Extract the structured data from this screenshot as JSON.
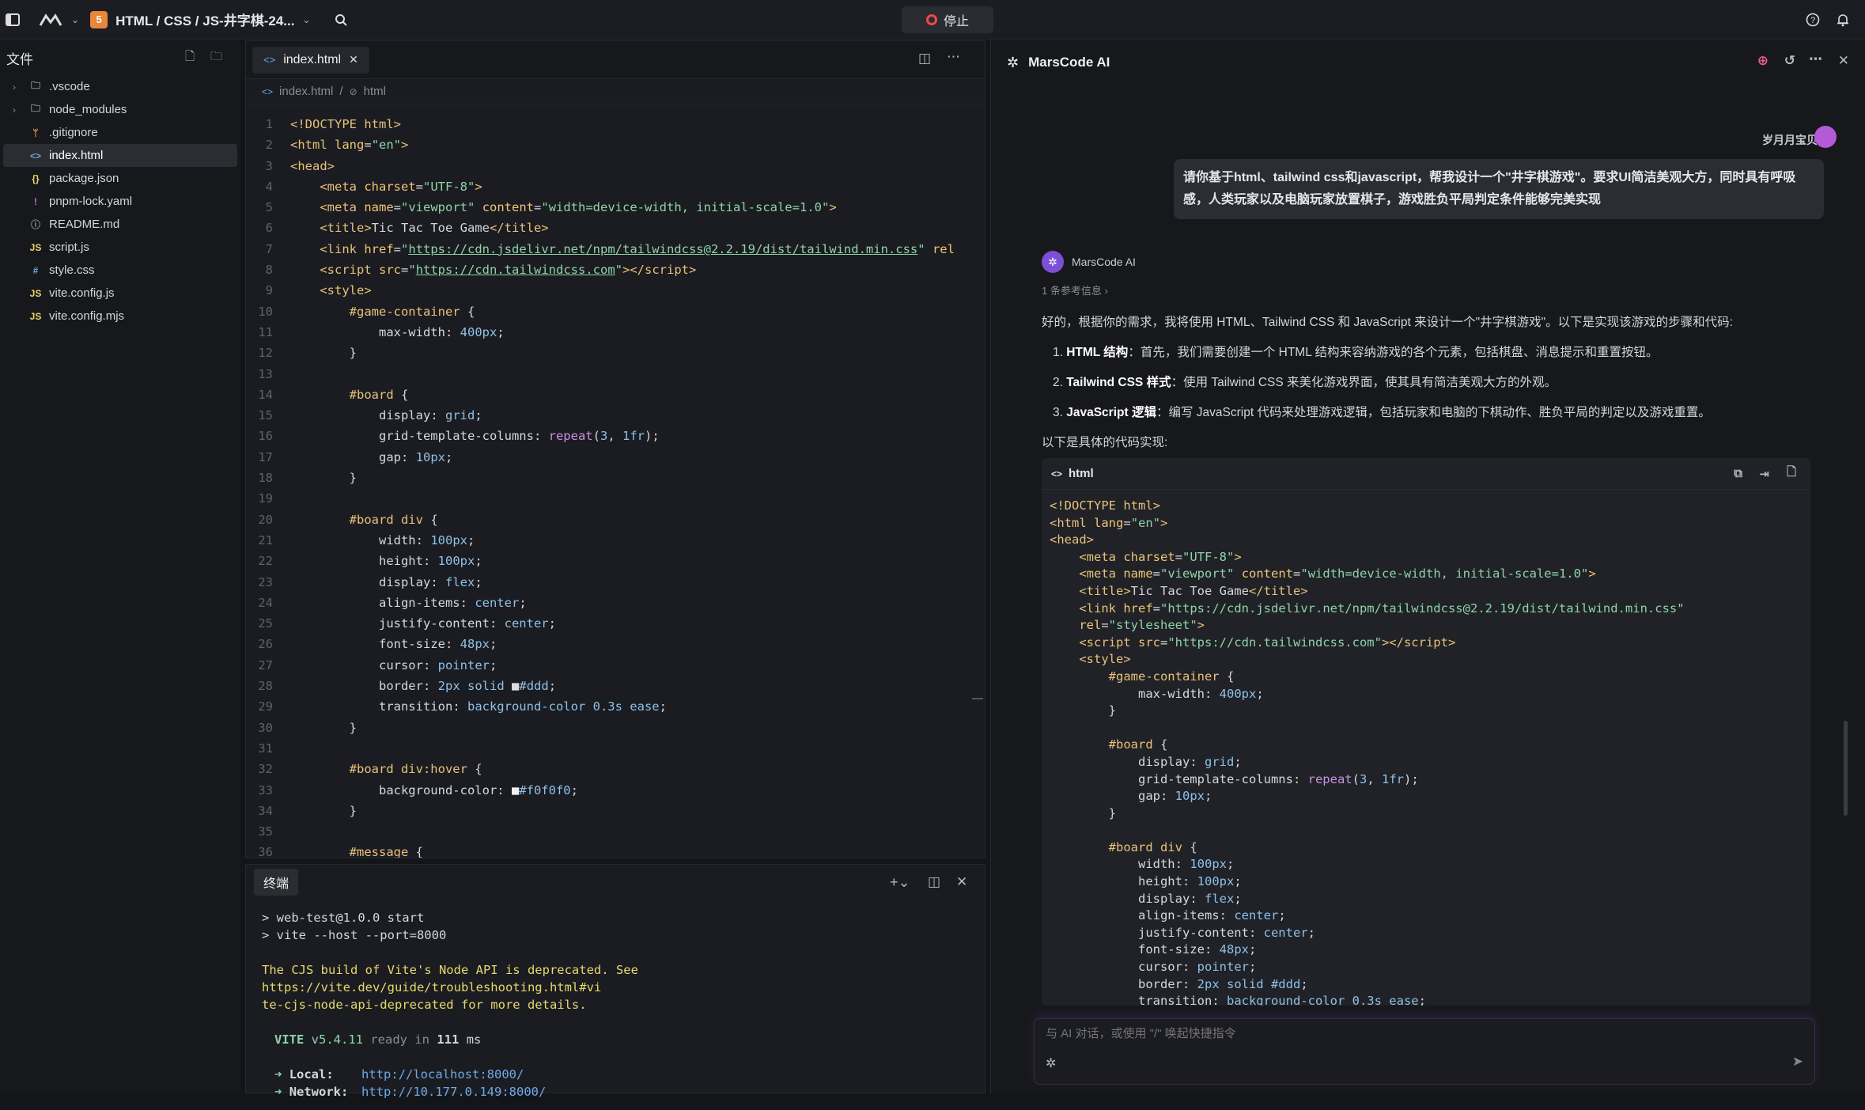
{
  "topbar": {
    "project_title": "HTML / CSS / JS-井字棋-24...",
    "stop_label": "停止",
    "badge": "5"
  },
  "sidebar": {
    "title": "文件",
    "items": [
      {
        "name": ".vscode",
        "icon": "folder-icon",
        "chev": true
      },
      {
        "name": "node_modules",
        "icon": "folder-icon",
        "chev": true
      },
      {
        "name": ".gitignore",
        "icon": "git-icon"
      },
      {
        "name": "index.html",
        "icon": "html-icon",
        "selected": true
      },
      {
        "name": "package.json",
        "icon": "json-icon"
      },
      {
        "name": "pnpm-lock.yaml",
        "icon": "yaml-icon"
      },
      {
        "name": "README.md",
        "icon": "info-icon"
      },
      {
        "name": "script.js",
        "icon": "js-icon"
      },
      {
        "name": "style.css",
        "icon": "css-icon"
      },
      {
        "name": "vite.config.js",
        "icon": "js-icon"
      },
      {
        "name": "vite.config.mjs",
        "icon": "js-icon"
      }
    ]
  },
  "editor": {
    "tab": "index.html",
    "breadcrumb": [
      "index.html",
      "html"
    ],
    "lines": [
      {
        "n": "1",
        "html": "<span class=\"t-tag\">&lt;!DOCTYPE html&gt;</span>"
      },
      {
        "n": "2",
        "html": "<span class=\"t-tag\">&lt;html</span> <span class=\"t-att\">lang</span>=<span class=\"t-str\">\"en\"</span><span class=\"t-tag\">&gt;</span>"
      },
      {
        "n": "3",
        "html": "<span class=\"t-tag\">&lt;head&gt;</span>"
      },
      {
        "n": "4",
        "html": "    <span class=\"t-tag\">&lt;meta</span> <span class=\"t-att\">charset</span>=<span class=\"t-str\">\"UTF-8\"</span><span class=\"t-tag\">&gt;</span>"
      },
      {
        "n": "5",
        "html": "    <span class=\"t-tag\">&lt;meta</span> <span class=\"t-att\">name</span>=<span class=\"t-str\">\"viewport\"</span> <span class=\"t-att\">content</span>=<span class=\"t-str\">\"width=device-width, initial-scale=1.0\"</span><span class=\"t-tag\">&gt;</span>"
      },
      {
        "n": "6",
        "html": "    <span class=\"t-tag\">&lt;title&gt;</span>Tic Tac Toe Game<span class=\"t-tag\">&lt;/title&gt;</span>"
      },
      {
        "n": "7",
        "html": "    <span class=\"t-tag\">&lt;link</span> <span class=\"t-att\">href</span>=<span class=\"t-str\">\"</span><span class=\"t-url\">https://cdn.jsdelivr.net/npm/tailwindcss@2.2.19/dist/tailwind.min.css</span><span class=\"t-str\">\"</span> <span class=\"t-att\">rel</span>"
      },
      {
        "n": "8",
        "html": "    <span class=\"t-tag\">&lt;script</span> <span class=\"t-att\">src</span>=<span class=\"t-str\">\"</span><span class=\"t-url\">https://cdn.tailwindcss.com</span><span class=\"t-str\">\"</span><span class=\"t-tag\">&gt;&lt;/script&gt;</span>"
      },
      {
        "n": "9",
        "html": "    <span class=\"t-tag\">&lt;style&gt;</span>"
      },
      {
        "n": "10",
        "html": "        <span class=\"t-sel\">#game-container</span> {"
      },
      {
        "n": "11",
        "html": "            <span class=\"t-prop\">max-width</span>: <span class=\"t-val\">400px</span>;"
      },
      {
        "n": "12",
        "html": "        }"
      },
      {
        "n": "13",
        "html": ""
      },
      {
        "n": "14",
        "html": "        <span class=\"t-sel\">#board</span> {"
      },
      {
        "n": "15",
        "html": "            <span class=\"t-prop\">display</span>: <span class=\"t-val\">grid</span>;"
      },
      {
        "n": "16",
        "html": "            <span class=\"t-prop\">grid-template-columns</span>: <span class=\"t-kw\">repeat</span>(<span class=\"t-val\">3</span>, <span class=\"t-val\">1fr</span>);"
      },
      {
        "n": "17",
        "html": "            <span class=\"t-prop\">gap</span>: <span class=\"t-val\">10px</span>;"
      },
      {
        "n": "18",
        "html": "        }"
      },
      {
        "n": "19",
        "html": ""
      },
      {
        "n": "20",
        "html": "        <span class=\"t-sel\">#board div</span> {"
      },
      {
        "n": "21",
        "html": "            <span class=\"t-prop\">width</span>: <span class=\"t-val\">100px</span>;"
      },
      {
        "n": "22",
        "html": "            <span class=\"t-prop\">height</span>: <span class=\"t-val\">100px</span>;"
      },
      {
        "n": "23",
        "html": "            <span class=\"t-prop\">display</span>: <span class=\"t-val\">flex</span>;"
      },
      {
        "n": "24",
        "html": "            <span class=\"t-prop\">align-items</span>: <span class=\"t-val\">center</span>;"
      },
      {
        "n": "25",
        "html": "            <span class=\"t-prop\">justify-content</span>: <span class=\"t-val\">center</span>;"
      },
      {
        "n": "26",
        "html": "            <span class=\"t-prop\">font-size</span>: <span class=\"t-val\">48px</span>;"
      },
      {
        "n": "27",
        "html": "            <span class=\"t-prop\">cursor</span>: <span class=\"t-val\">pointer</span>;"
      },
      {
        "n": "28",
        "html": "            <span class=\"t-prop\">border</span>: <span class=\"t-val\">2px</span> <span class=\"t-val\">solid</span> <span style=\"color:#ddd\">■</span><span class=\"t-val\">#ddd</span>;"
      },
      {
        "n": "29",
        "html": "            <span class=\"t-prop\">transition</span>: <span class=\"t-val\">background-color 0.3s ease</span>;"
      },
      {
        "n": "30",
        "html": "        }"
      },
      {
        "n": "31",
        "html": ""
      },
      {
        "n": "32",
        "html": "        <span class=\"t-sel\">#board div:hover</span> {"
      },
      {
        "n": "33",
        "html": "            <span class=\"t-prop\">background-color</span>: <span style=\"color:#f0f0f0\">■</span><span class=\"t-val\">#f0f0f0</span>;"
      },
      {
        "n": "34",
        "html": "        }"
      },
      {
        "n": "35",
        "html": ""
      },
      {
        "n": "36",
        "html": "        <span class=\"t-sel\">#message</span> {"
      }
    ]
  },
  "terminal": {
    "tab": "终端",
    "lines": [
      "> web-test@1.0.0 start",
      "> vite --host --port=8000"
    ],
    "warning": "The CJS build of Vite's Node API is deprecated. See https://vite.dev/guide/troubleshooting.html#vi\nte-cjs-node-api-deprecated for more details.",
    "vite_label": "VITE",
    "vite_version": "v5.4.11",
    "ready_text": "ready in",
    "ready_ms": "111",
    "ms": "ms",
    "local_label": "Local:",
    "local_url": "http://localhost:8000/",
    "network_label": "Network:",
    "network_url": "http://10.177.0.149:8000/"
  },
  "ai": {
    "title": "MarsCode AI",
    "user_name": "岁月月宝贝",
    "user_message": "请你基于html、tailwind css和javascript，帮我设计一个\"井字棋游戏\"。要求UI简洁美观大方，同时具有呼吸感，人类玩家以及电脑玩家放置棋子，游戏胜负平局判定条件能够完美实现",
    "bot_name": "MarsCode AI",
    "refs": "1 条参考信息",
    "intro": "好的，根据你的需求，我将使用 HTML、Tailwind CSS 和 JavaScript 来设计一个\"井字棋游戏\"。以下是实现该游戏的步骤和代码:",
    "steps": [
      {
        "title": "HTML 结构",
        "text": "：首先，我们需要创建一个 HTML 结构来容纳游戏的各个元素，包括棋盘、消息提示和重置按钮。"
      },
      {
        "title": "Tailwind CSS 样式",
        "text": "：使用 Tailwind CSS 来美化游戏界面，使其具有简洁美观大方的外观。"
      },
      {
        "title": "JavaScript 逻辑",
        "text": "：编写 JavaScript 代码来处理游戏逻辑，包括玩家和电脑的下棋动作、胜负平局的判定以及游戏重置。"
      }
    ],
    "outro": "以下是具体的代码实现:",
    "code_lang": "html",
    "code_html": "<span class=\"t-tag\">&lt;!DOCTYPE html&gt;</span>\n<span class=\"t-tag\">&lt;html</span> <span class=\"t-att\">lang</span>=<span class=\"t-str\">\"en\"</span><span class=\"t-tag\">&gt;</span>\n<span class=\"t-tag\">&lt;head&gt;</span>\n    <span class=\"t-tag\">&lt;meta</span> <span class=\"t-att\">charset</span>=<span class=\"t-str\">\"UTF-8\"</span><span class=\"t-tag\">&gt;</span>\n    <span class=\"t-tag\">&lt;meta</span> <span class=\"t-att\">name</span>=<span class=\"t-str\">\"viewport\"</span> <span class=\"t-att\">content</span>=<span class=\"t-str\">\"width=device-width, initial-scale=1.0\"</span><span class=\"t-tag\">&gt;</span>\n    <span class=\"t-tag\">&lt;title&gt;</span>Tic Tac Toe Game<span class=\"t-tag\">&lt;/title&gt;</span>\n    <span class=\"t-tag\">&lt;link</span> <span class=\"t-att\">href</span>=<span class=\"t-str\">\"https://cdn.jsdelivr.net/npm/tailwindcss@2.2.19/dist/tailwind.min.css\"</span>\n    <span class=\"t-att\">rel</span>=<span class=\"t-str\">\"stylesheet\"</span><span class=\"t-tag\">&gt;</span>\n    <span class=\"t-tag\">&lt;script</span> <span class=\"t-att\">src</span>=<span class=\"t-str\">\"https://cdn.tailwindcss.com\"</span><span class=\"t-tag\">&gt;&lt;/script&gt;</span>\n    <span class=\"t-tag\">&lt;style&gt;</span>\n        <span class=\"t-sel\">#game-container</span> {\n            <span class=\"t-prop\">max-width</span>: <span class=\"t-val\">400px</span>;\n        }\n\n        <span class=\"t-sel\">#board</span> {\n            <span class=\"t-prop\">display</span>: <span class=\"t-val\">grid</span>;\n            <span class=\"t-prop\">grid-template-columns</span>: <span class=\"t-kw\">repeat</span>(<span class=\"t-val\">3</span>, <span class=\"t-val\">1fr</span>);\n            <span class=\"t-prop\">gap</span>: <span class=\"t-val\">10px</span>;\n        }\n\n        <span class=\"t-sel\">#board div</span> {\n            <span class=\"t-prop\">width</span>: <span class=\"t-val\">100px</span>;\n            <span class=\"t-prop\">height</span>: <span class=\"t-val\">100px</span>;\n            <span class=\"t-prop\">display</span>: <span class=\"t-val\">flex</span>;\n            <span class=\"t-prop\">align-items</span>: <span class=\"t-val\">center</span>;\n            <span class=\"t-prop\">justify-content</span>: <span class=\"t-val\">center</span>;\n            <span class=\"t-prop\">font-size</span>: <span class=\"t-val\">48px</span>;\n            <span class=\"t-prop\">cursor</span>: <span class=\"t-val\">pointer</span>;\n            <span class=\"t-prop\">border</span>: <span class=\"t-val\">2px solid #ddd</span>;\n            <span class=\"t-prop\">transition</span>: <span class=\"t-val\">background-color 0.3s ease</span>;",
    "input_placeholder": "与 AI 对话，或使用 \"/\" 唤起快捷指令"
  }
}
